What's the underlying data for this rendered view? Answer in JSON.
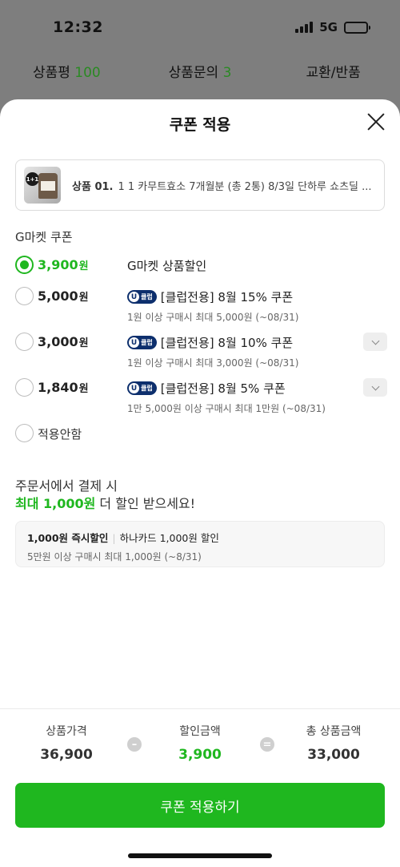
{
  "status_bar": {
    "time": "12:32",
    "network": "5G"
  },
  "background_tabs": [
    {
      "label": "상품평",
      "count": "100"
    },
    {
      "label": "상품문의",
      "count": "3"
    },
    {
      "label": "교환/반품",
      "count": ""
    }
  ],
  "sheet": {
    "title": "쿠폰 적용",
    "product": {
      "badge": "1+1",
      "label": "상품 01.",
      "name": "1 1 카무트효소 7개월분 (총 2통) 8/3일 단하루 쇼츠딜 ..."
    },
    "section_label": "G마켓 쿠폰",
    "coupons": [
      {
        "amount": "3,900",
        "unit": "원",
        "selected": true,
        "club": false,
        "title": "G마켓 상품할인",
        "sub": "",
        "expand": false
      },
      {
        "amount": "5,000",
        "unit": "원",
        "selected": false,
        "club": true,
        "title": "[클럽전용] 8월 15% 쿠폰",
        "sub": "1원 이상 구매시 최대 5,000원 (~08/31)",
        "expand": false
      },
      {
        "amount": "3,000",
        "unit": "원",
        "selected": false,
        "club": true,
        "title": "[클럽전용] 8월 10% 쿠폰",
        "sub": "1원 이상 구매시 최대 3,000원 (~08/31)",
        "expand": true
      },
      {
        "amount": "1,840",
        "unit": "원",
        "selected": false,
        "club": true,
        "title": "[클럽전용] 8월 5% 쿠폰",
        "sub": "1만 5,000원 이상 구매시 최대 1만원 (~08/31)",
        "expand": true
      }
    ],
    "club_badge": {
      "letter": "U",
      "text": "클럽"
    },
    "no_apply_label": "적용안함",
    "promo": {
      "line1": "주문서에서 결제 시",
      "line2_highlight": "최대 1,000원",
      "line2_rest": " 더 할인 받으세요!"
    },
    "card_offer": {
      "title": "1,000원 즉시할인",
      "card": "하나카드 1,000원 할인",
      "sub": "5만원 이상 구매시 최대 1,000원 (~8/31)"
    },
    "summary": {
      "price_label": "상품가격",
      "price": "36,900",
      "minus": "–",
      "discount_label": "할인금액",
      "discount": "3,900",
      "equals": "=",
      "total_label": "총 상품금액",
      "total": "33,000"
    },
    "apply_button": "쿠폰 적용하기"
  },
  "colors": {
    "accent": "#1fb71f",
    "club": "#0d2f6d",
    "tab_count": "#2a8a23",
    "overlay": "#7e7e7e"
  }
}
